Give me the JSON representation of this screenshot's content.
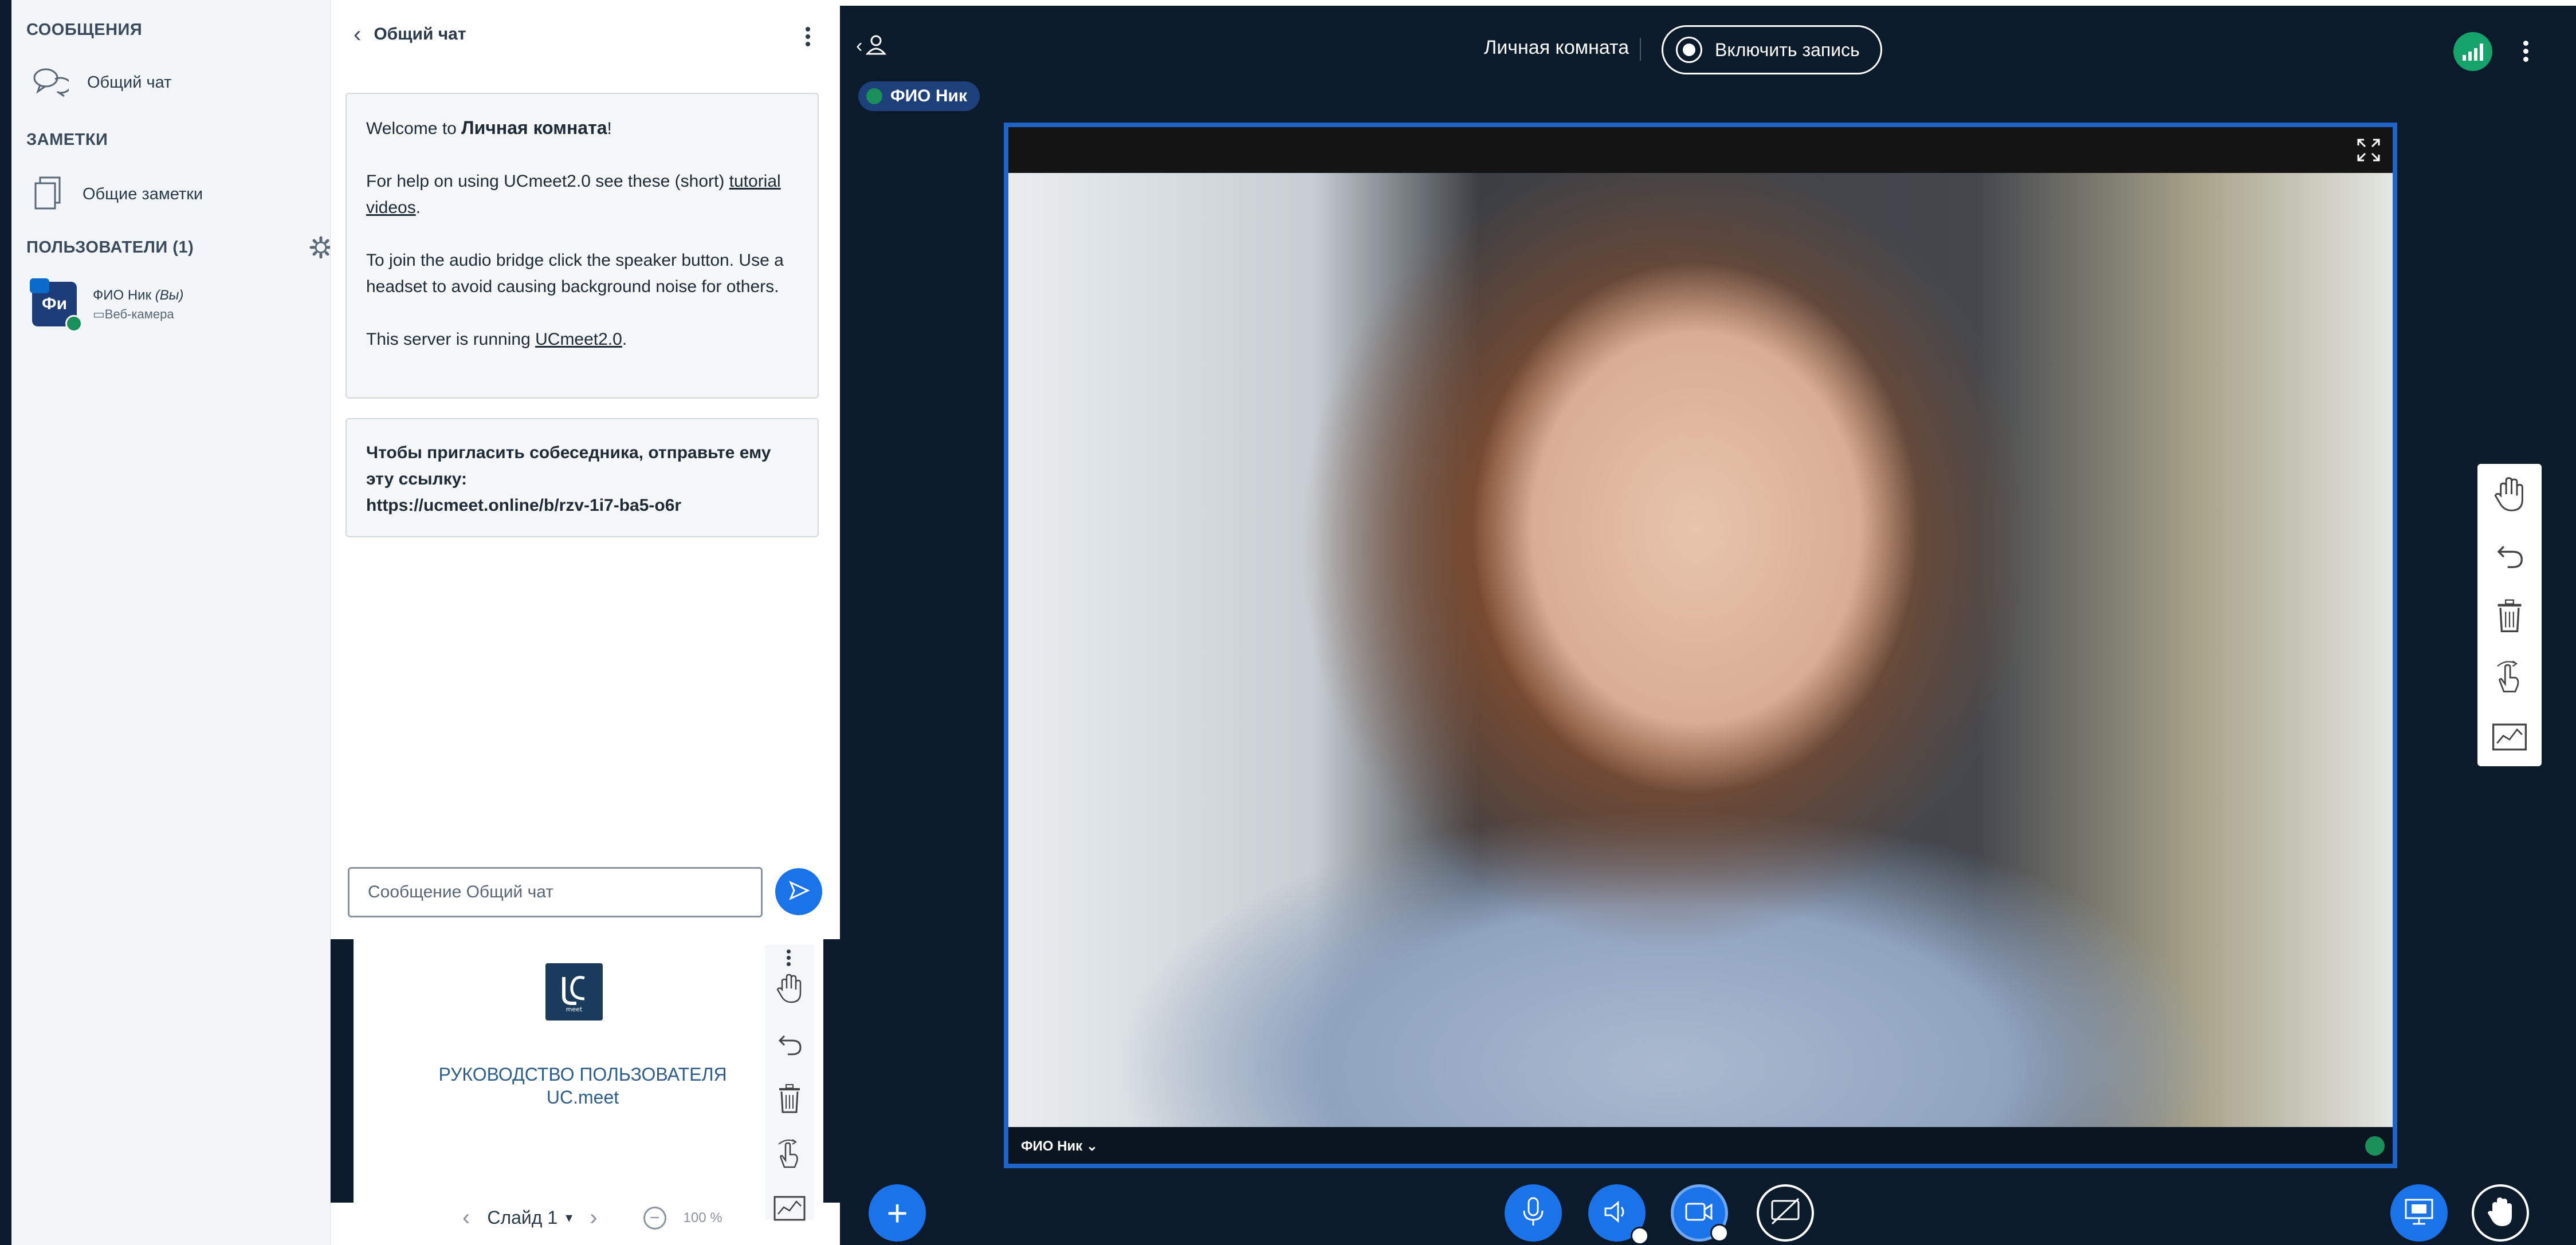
{
  "sidebar": {
    "messages_title": "СООБЩЕНИЯ",
    "public_chat_label": "Общий чат",
    "notes_title": "ЗАМЕТКИ",
    "shared_notes_label": "Общие заметки",
    "users_title": "ПОЛЬЗОВАТЕЛИ (1)",
    "user": {
      "avatar_initials": "Фи",
      "name": "ФИО Ник",
      "you_suffix": "(Вы)",
      "status": "Веб-камера"
    }
  },
  "chat": {
    "title": "Общий чат",
    "welcome": {
      "line1_prefix": "Welcome to ",
      "room_name": "Личная комната",
      "line1_suffix": "!",
      "help_prefix": "For help on using UCmeet2.0 see these (short) ",
      "help_link_1": "tutorial",
      "help_link_2": "videos",
      "help_suffix": ".",
      "audio_text": "To join the audio bridge click the speaker button. Use a headset to avoid causing background noise for others.",
      "server_prefix": "This server is running ",
      "server_link": "UCmeet2.0",
      "server_suffix": "."
    },
    "invite": {
      "text": "Чтобы пригласить собеседника, отправьте ему эту ссылку:",
      "url": "https://ucmeet.online/b/rzv-1i7-ba5-o6r"
    },
    "input_placeholder": "Сообщение Общий чат"
  },
  "presentation": {
    "logo_text": "meet",
    "title_line1": "РУКОВОДСТВО ПОЛЬЗОВАТЕЛЯ",
    "title_line2": "UC.meet",
    "slide_label": "Слайд 1",
    "zoom_label": "100 %"
  },
  "main": {
    "room_title": "Личная комната",
    "record_label": "Включить запись",
    "talker_name": "ФИО Ник",
    "video_name_tag": "ФИО Ник ⌄"
  },
  "colors": {
    "accent": "#1a73e8",
    "dark_bg": "#0b1b2c",
    "connection_good": "#16a36b",
    "video_border": "#1e64c8"
  },
  "icons": {
    "chat": "chat-bubbles-icon",
    "notes": "notes-icon",
    "settings": "gear-icon",
    "send": "send-icon",
    "pan": "hand-icon",
    "undo": "undo-icon",
    "delete": "trash-icon",
    "multi_user": "multi-user-pointer-icon",
    "whiteboard": "whiteboard-icon"
  }
}
